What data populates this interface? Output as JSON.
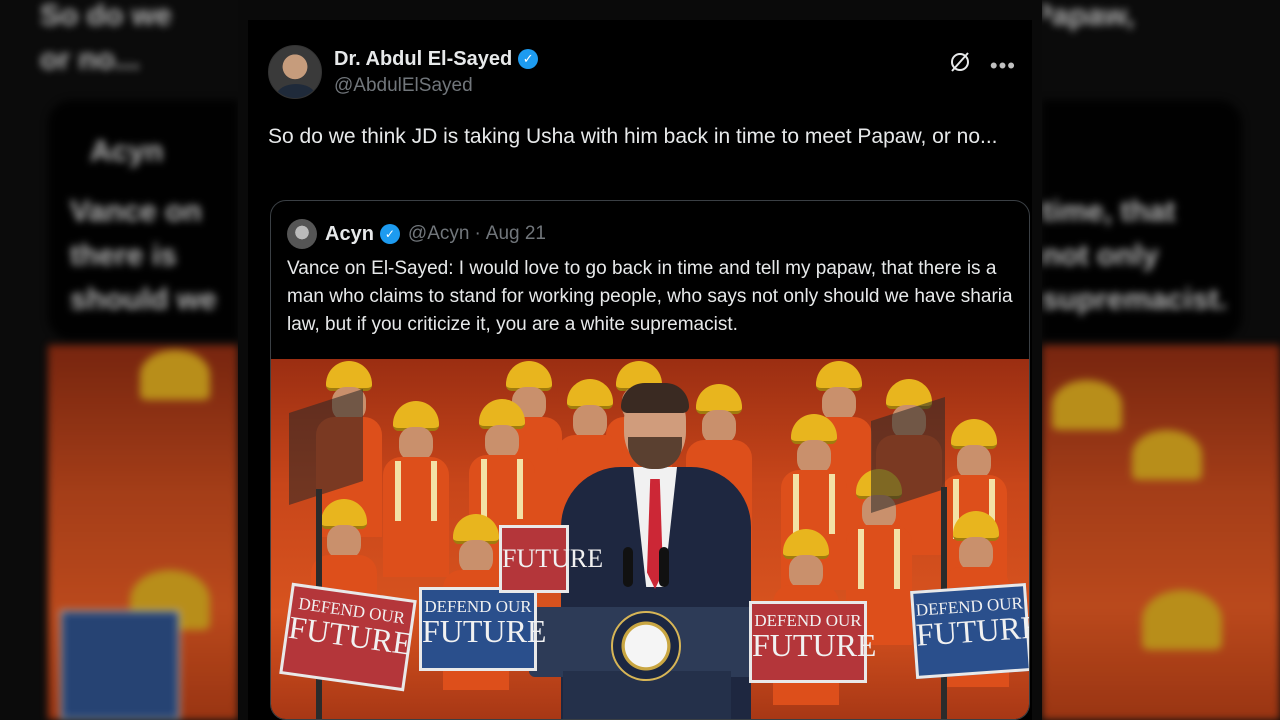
{
  "tweet": {
    "author": {
      "display_name": "Dr. Abdul El-Sayed",
      "handle": "@AbdulElSayed",
      "verified": true
    },
    "text": "So do we think JD is taking Usha with him back in time to meet Papaw, or no...",
    "icons": [
      "grok-icon",
      "more-icon"
    ]
  },
  "quote": {
    "author": {
      "display_name": "Acyn",
      "handle": "@Acyn",
      "verified": true
    },
    "separator": "·",
    "date": "Aug 21",
    "text": "Vance on El-Sayed: I would love to go back in time and tell my papaw, that there is a man who claims to stand for working people, who says not only should we have sharia law, but if you criticize it, you are a white supremacist."
  },
  "image": {
    "signs": [
      {
        "line1": "DEFEND OUR",
        "line2": "FUTURE"
      },
      {
        "line1": "DEFEND OUR",
        "line2": "FUTURE"
      },
      {
        "line1": "DEFEND OUR",
        "line2": "FUTURE"
      },
      {
        "line1": "DEFEND OUR",
        "line2": "FUTURE"
      },
      {
        "line1": "DEFEND OUR",
        "line2": "FUTURE"
      }
    ]
  },
  "colors": {
    "accent": "#1d9bf0",
    "background": "#000000",
    "text_primary": "#e7e9ea",
    "text_secondary": "#71767b"
  }
}
